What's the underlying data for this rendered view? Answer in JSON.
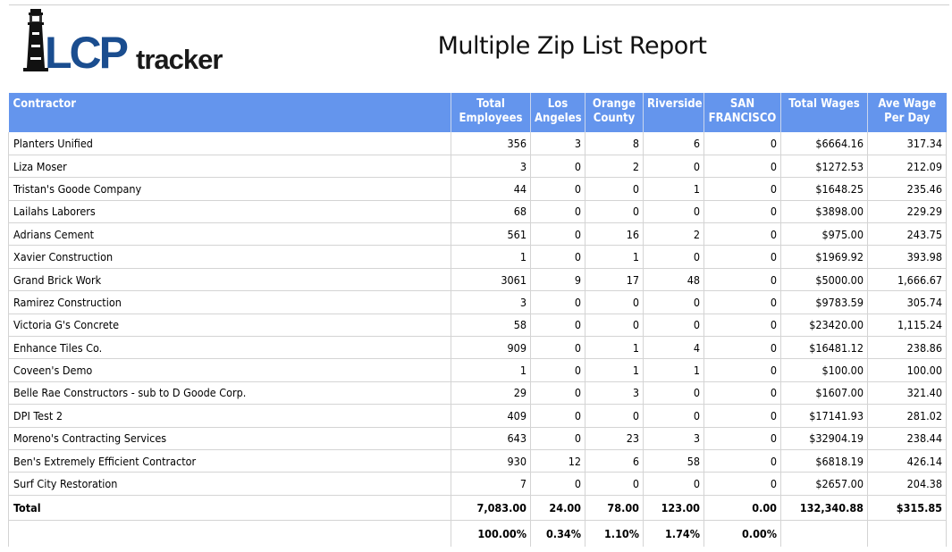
{
  "brand": {
    "logo_text_lcp": "LCP",
    "logo_text_tracker": "tracker",
    "lcp_color": "#1a4d8f",
    "tracker_color": "#1a1a1a"
  },
  "report": {
    "title": "Multiple Zip List Report"
  },
  "header_color": "#6495ed",
  "columns": [
    "Contractor",
    "Total Employees",
    "Los Angeles",
    "Orange County",
    "Riverside",
    "SAN FRANCISCO",
    "Total Wages",
    "Ave Wage Per Day"
  ],
  "rows": [
    [
      "Planters Unified",
      "356",
      "3",
      "8",
      "6",
      "0",
      "$6664.16",
      "317.34"
    ],
    [
      "Liza Moser",
      "3",
      "0",
      "2",
      "0",
      "0",
      "$1272.53",
      "212.09"
    ],
    [
      "Tristan's Goode Company",
      "44",
      "0",
      "0",
      "1",
      "0",
      "$1648.25",
      "235.46"
    ],
    [
      "Lailahs Laborers",
      "68",
      "0",
      "0",
      "0",
      "0",
      "$3898.00",
      "229.29"
    ],
    [
      "Adrians Cement",
      "561",
      "0",
      "16",
      "2",
      "0",
      "$975.00",
      "243.75"
    ],
    [
      "Xavier Construction",
      "1",
      "0",
      "1",
      "0",
      "0",
      "$1969.92",
      "393.98"
    ],
    [
      "Grand Brick Work",
      "3061",
      "9",
      "17",
      "48",
      "0",
      "$5000.00",
      "1,666.67"
    ],
    [
      "Ramirez Construction",
      "3",
      "0",
      "0",
      "0",
      "0",
      "$9783.59",
      "305.74"
    ],
    [
      "Victoria G's Concrete",
      "58",
      "0",
      "0",
      "0",
      "0",
      "$23420.00",
      "1,115.24"
    ],
    [
      "Enhance Tiles Co.",
      "909",
      "0",
      "1",
      "4",
      "0",
      "$16481.12",
      "238.86"
    ],
    [
      "Coveen's Demo",
      "1",
      "0",
      "1",
      "1",
      "0",
      "$100.00",
      "100.00"
    ],
    [
      "Belle Rae Constructors - sub to D Goode Corp.",
      "29",
      "0",
      "3",
      "0",
      "0",
      "$1607.00",
      "321.40"
    ],
    [
      "DPI Test 2",
      "409",
      "0",
      "0",
      "0",
      "0",
      "$17141.93",
      "281.02"
    ],
    [
      "Moreno's Contracting Services",
      "643",
      "0",
      "23",
      "3",
      "0",
      "$32904.19",
      "238.44"
    ],
    [
      "Ben's Extremely Efficient Contractor",
      "930",
      "12",
      "6",
      "58",
      "0",
      "$6818.19",
      "426.14"
    ],
    [
      "Surf City Restoration",
      "7",
      "0",
      "0",
      "0",
      "0",
      "$2657.00",
      "204.38"
    ]
  ],
  "total_row": [
    "Total",
    "7,083.00",
    "24.00",
    "78.00",
    "123.00",
    "0.00",
    "132,340.88",
    "$315.85"
  ],
  "percent_row": [
    "",
    "100.00%",
    "0.34%",
    "1.10%",
    "1.74%",
    "0.00%",
    "",
    ""
  ]
}
